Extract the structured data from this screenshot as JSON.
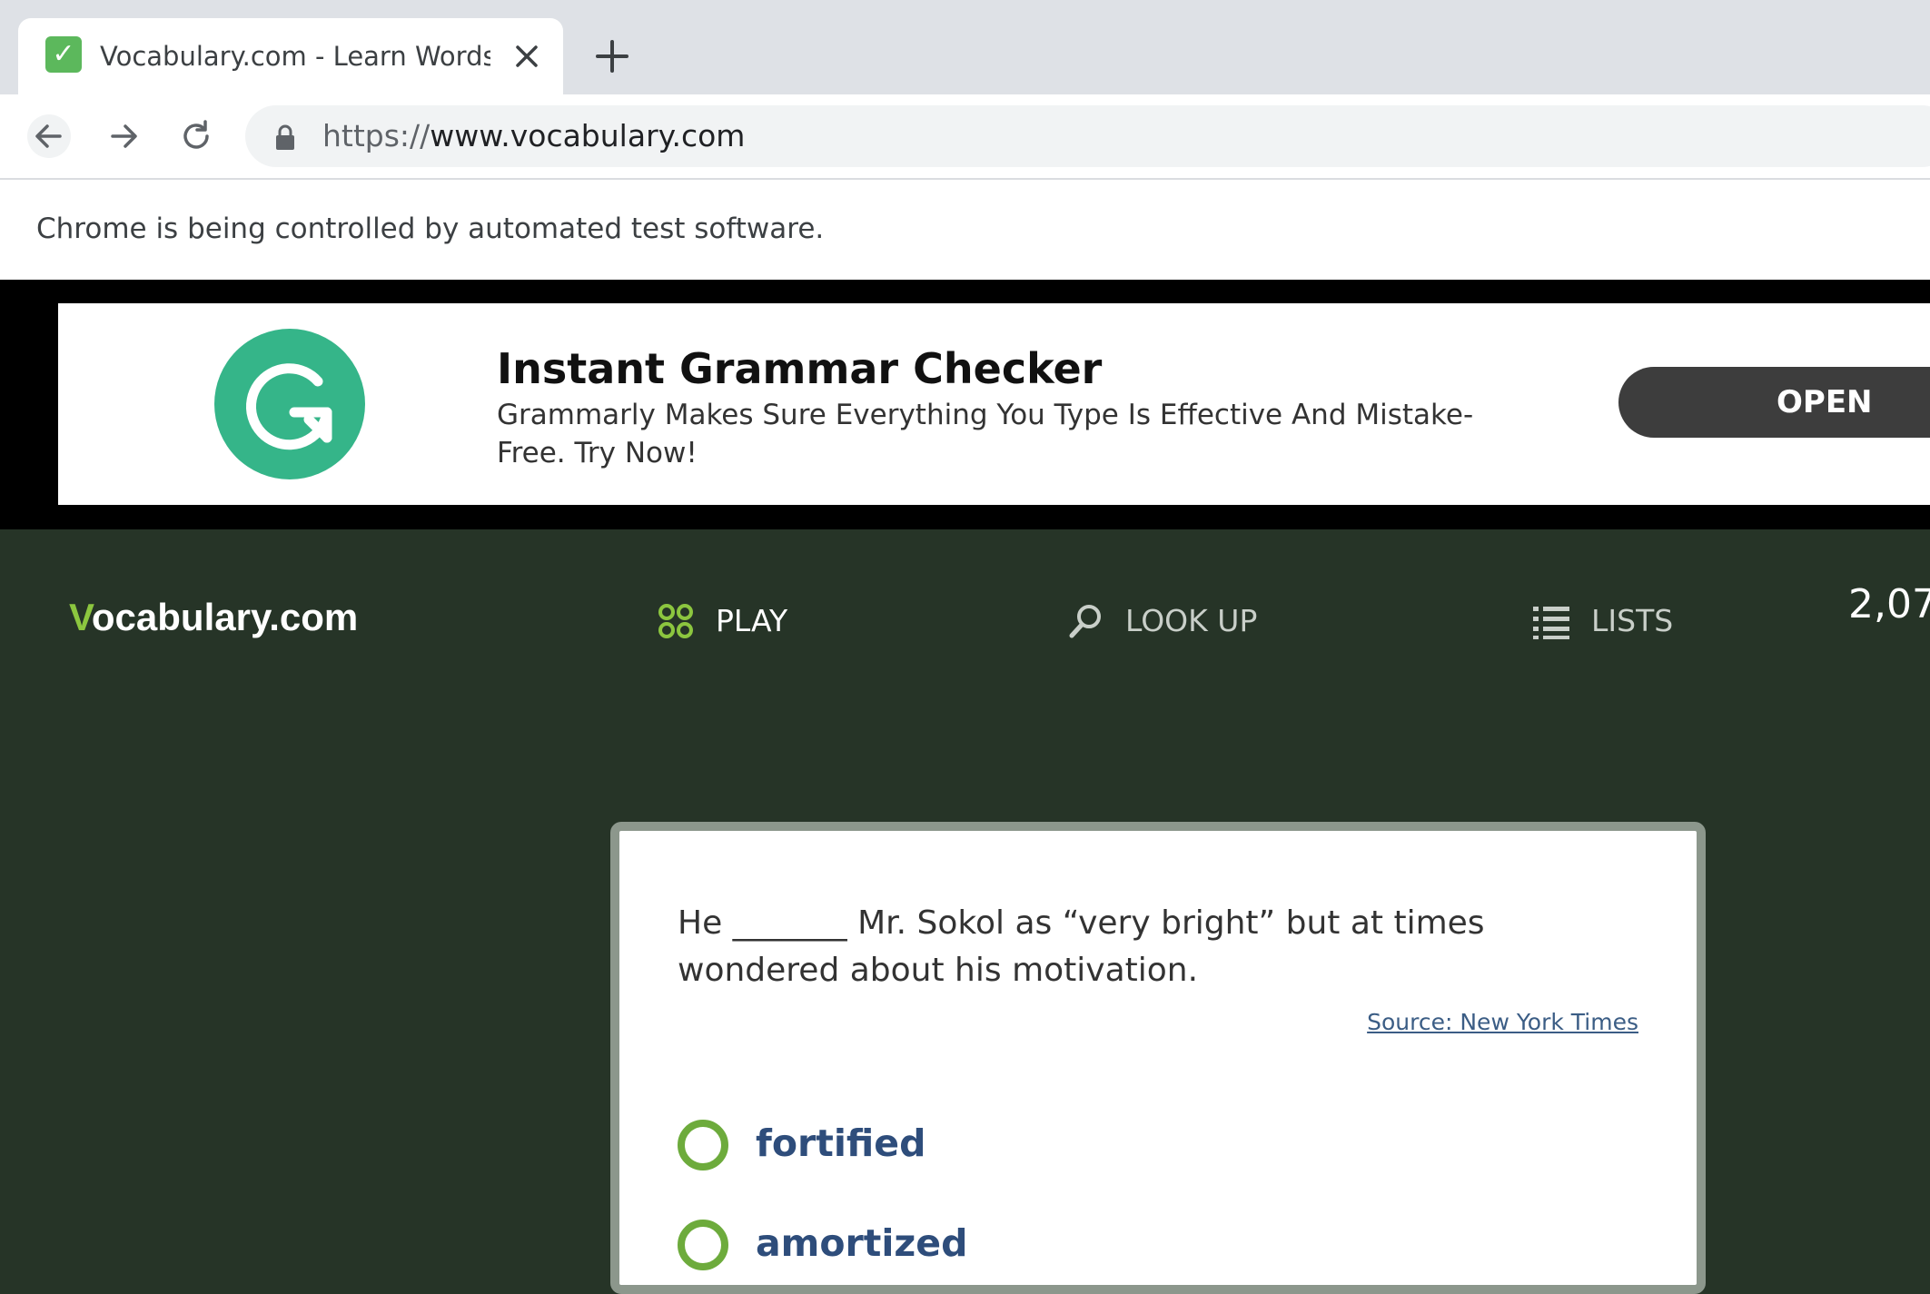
{
  "browser": {
    "tab_title": "Vocabulary.com - Learn Words - ",
    "favicon": "vocabulary-check-favicon",
    "url_scheme": "https://",
    "url_host": "www.vocabulary.com",
    "infobar_text": "Chrome is being controlled by automated test software."
  },
  "ad": {
    "title": "Instant Grammar Checker",
    "description": "Grammarly Makes Sure Everything You Type Is Effective And Mistake-Free. Try Now!",
    "button_label": "OPEN",
    "logo_icon": "grammarly-logo-icon",
    "logo_color": "#35b589",
    "button_color": "#3d3d3d"
  },
  "site": {
    "logo_v": "V",
    "logo_rest": "ocabulary.com",
    "nav": [
      {
        "label": "PLAY",
        "icon": "play-grid-icon"
      },
      {
        "label": "LOOK UP",
        "icon": "search-icon"
      },
      {
        "label": "LISTS",
        "icon": "list-icon"
      }
    ],
    "points": "2,07",
    "header_bg": "#263427",
    "accent": "#8cc63f"
  },
  "question": {
    "sentence": "He _______ Mr. Sokol as “very bright” but at times wondered about his motivation.",
    "source": "Source: New York Times",
    "choices": [
      "fortified",
      "amortized"
    ]
  }
}
